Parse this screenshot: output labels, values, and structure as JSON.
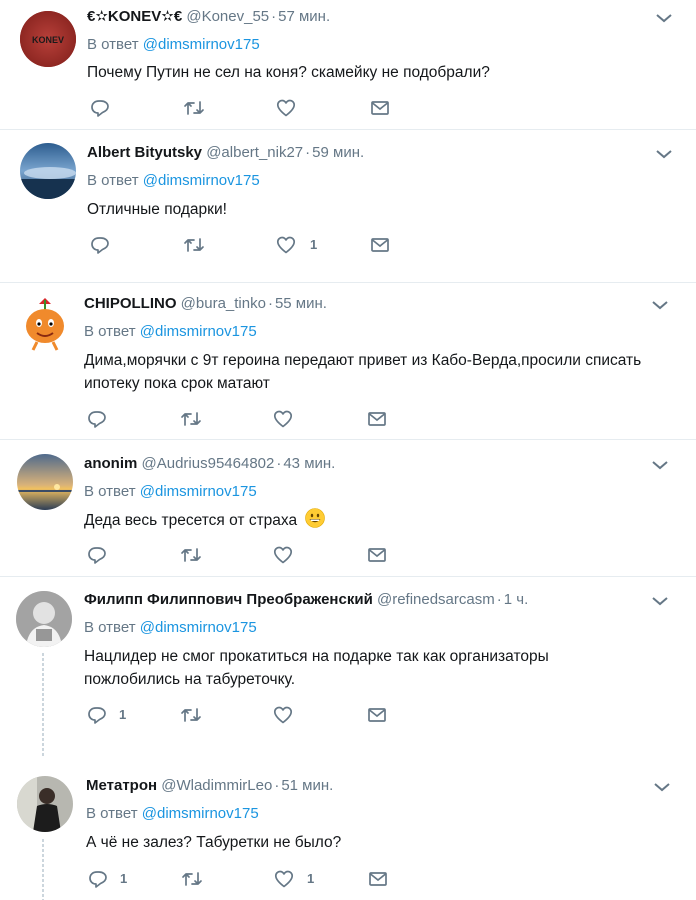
{
  "reply_label": "В ответ",
  "tweets": [
    {
      "name": "€✫KONEV✫€",
      "handle": "@Konev_55",
      "time": "57 мин.",
      "reply_to": "@dimsmirnov175",
      "text": "Почему Путин не сел на коня? скамейку не подобрали?",
      "avatar_text": "KONEV",
      "counts": {
        "reply": "",
        "retweet": "",
        "like": ""
      }
    },
    {
      "name": "Albert Bityutsky",
      "handle": "@albert_nik27",
      "time": "59 мин.",
      "reply_to": "@dimsmirnov175",
      "text": "Отличные подарки!",
      "counts": {
        "reply": "",
        "retweet": "",
        "like": "1"
      }
    },
    {
      "name": "CHIPOLLINO",
      "handle": "@bura_tinko",
      "time": "55 мин.",
      "reply_to": "@dimsmirnov175",
      "text_line1": "Дима,морячки с 9т героина передают привет из Кабо-Верда,просили списать",
      "text_line2": "ипотеку пока срок матают",
      "counts": {
        "reply": "",
        "retweet": "",
        "like": ""
      }
    },
    {
      "name": "anonim",
      "handle": "@Audrius95464802",
      "time": "43 мин.",
      "reply_to": "@dimsmirnov175",
      "text": "Деда весь тресется от страха",
      "emoji": "grinning-face",
      "counts": {
        "reply": "",
        "retweet": "",
        "like": ""
      }
    },
    {
      "name": "Филипп Филиппович Преображенский",
      "handle": "@refinedsarcasm",
      "time": "1 ч.",
      "reply_to": "@dimsmirnov175",
      "text_line1": "Нацлидер не смог прокатиться на подарке так как организаторы",
      "text_line2": "пожлобились на табуреточку.",
      "counts": {
        "reply": "1",
        "retweet": "",
        "like": ""
      }
    },
    {
      "name": "Метатрон",
      "handle": "@WladimmirLeo",
      "time": "51 мин.",
      "reply_to": "@dimsmirnov175",
      "text": "А чё не залез? Табуретки не было?",
      "counts": {
        "reply": "1",
        "retweet": "",
        "like": "1"
      }
    }
  ],
  "icons": [
    "reply-icon",
    "retweet-icon",
    "like-icon",
    "dm-icon",
    "chevron-down-icon"
  ],
  "colors": {
    "link": "#1b95e0",
    "secondary": "#657786",
    "text": "#14171a",
    "divider": "#e6ecf0"
  }
}
